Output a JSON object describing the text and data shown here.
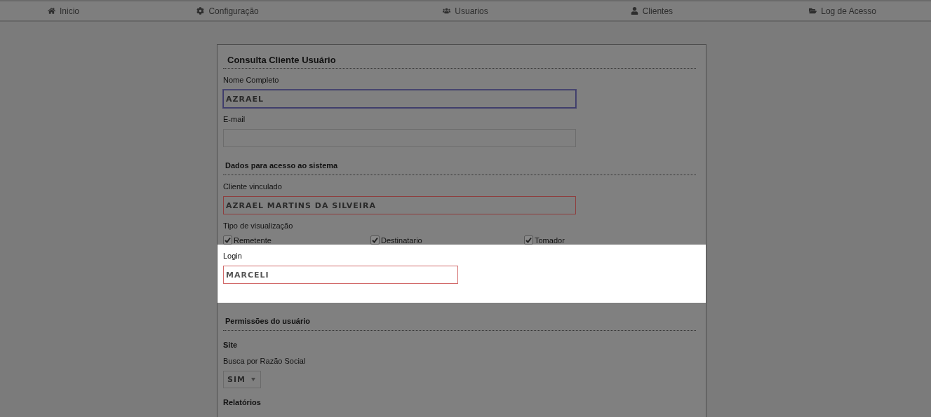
{
  "nav": {
    "items": [
      {
        "label": "Inicio"
      },
      {
        "label": "Configuração"
      },
      {
        "label": "Usuarios"
      },
      {
        "label": "Clientes"
      },
      {
        "label": "Log de Acesso"
      }
    ]
  },
  "form": {
    "title": "Consulta Cliente Usuário",
    "sections": [
      {
        "highlighted": false,
        "items": [
          {
            "kind": "text",
            "label": "Nome Completo",
            "value": "AZRAEL",
            "focused": true,
            "invalid": false,
            "wide": true
          },
          {
            "kind": "text",
            "label": "E-mail",
            "focused": false,
            "invalid": false,
            "wide": true
          },
          {
            "kind": "heading",
            "label": "Dados para acesso ao sistema"
          },
          {
            "kind": "text",
            "label": "Cliente vinculado",
            "value": "AZRAEL MARTINS DA SILVEIRA",
            "focused": false,
            "invalid": true,
            "wide": true
          },
          {
            "kind": "checks",
            "label": "Tipo de visualização",
            "options": [
              {
                "label": "Remetente",
                "checked": true
              },
              {
                "label": "Destinatario",
                "checked": true
              },
              {
                "label": "Tomador",
                "checked": true
              }
            ]
          }
        ]
      },
      {
        "highlighted": true,
        "items": [
          {
            "kind": "text",
            "label": "Login",
            "value": "MARCELI",
            "focused": false,
            "invalid": true,
            "wide": false
          }
        ]
      },
      {
        "highlighted": false,
        "items": [
          {
            "kind": "heading",
            "label": "Permissões do usuário"
          },
          {
            "kind": "subheading",
            "label": "Site"
          },
          {
            "kind": "select",
            "label": "Busca por Razão Social",
            "value": "SIM"
          },
          {
            "kind": "subheading",
            "label": "Relatórios"
          }
        ]
      }
    ]
  }
}
